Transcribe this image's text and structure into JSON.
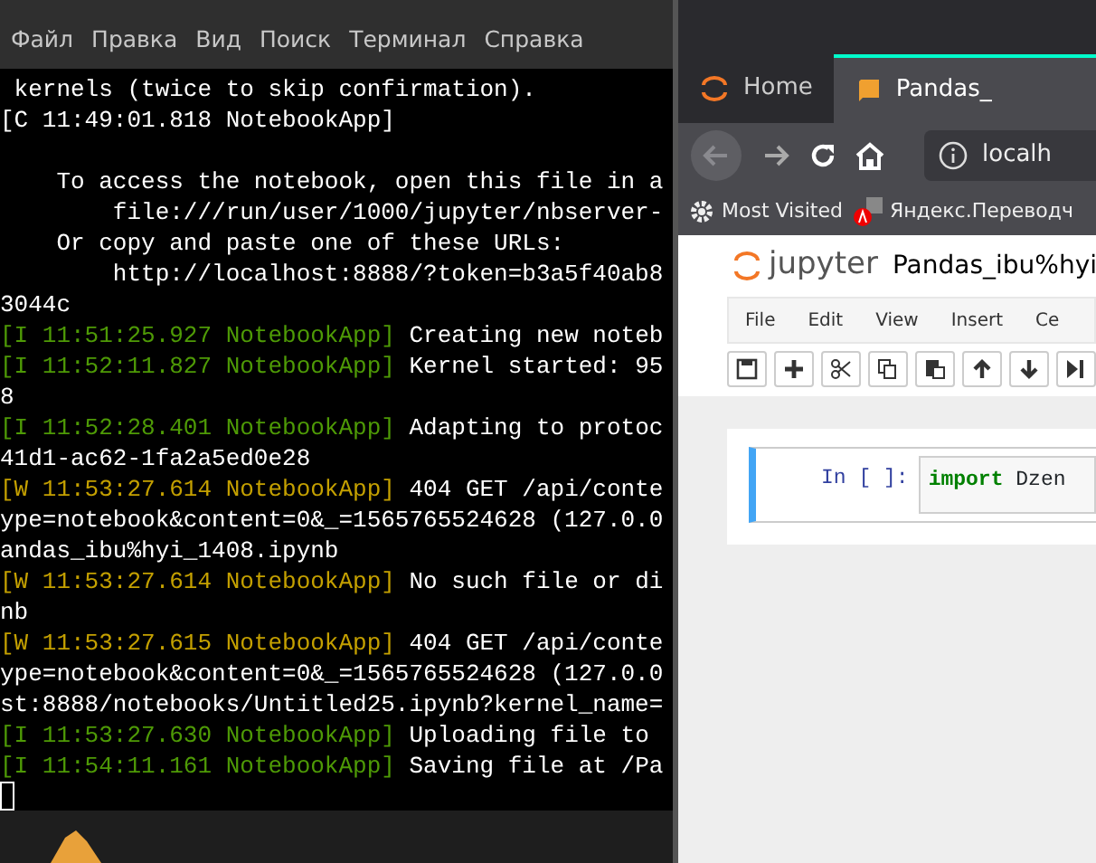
{
  "terminal": {
    "menu": [
      "Файл",
      "Правка",
      "Вид",
      "Поиск",
      "Терминал",
      "Справка"
    ],
    "lines": [
      {
        "kind": "plain",
        "text": " kernels (twice to skip confirmation)."
      },
      {
        "kind": "plain",
        "text": "[C 11:49:01.818 NotebookApp]"
      },
      {
        "kind": "blank"
      },
      {
        "kind": "plain",
        "text": "    To access the notebook, open this file in a"
      },
      {
        "kind": "plain",
        "text": "        file:///run/user/1000/jupyter/nbserver-"
      },
      {
        "kind": "plain",
        "text": "    Or copy and paste one of these URLs:"
      },
      {
        "kind": "plain",
        "text": "        http://localhost:8888/?token=b3a5f40ab8"
      },
      {
        "kind": "plain",
        "text": "3044c"
      },
      {
        "kind": "info",
        "prefix": "[I 11:51:25.927 NotebookApp]",
        "text": "Creating new noteb"
      },
      {
        "kind": "info",
        "prefix": "[I 11:52:11.827 NotebookApp]",
        "text": "Kernel started: 95"
      },
      {
        "kind": "plain",
        "text": "8"
      },
      {
        "kind": "info",
        "prefix": "[I 11:52:28.401 NotebookApp]",
        "text": "Adapting to protoc"
      },
      {
        "kind": "plain",
        "text": "41d1-ac62-1fa2a5ed0e28"
      },
      {
        "kind": "warn",
        "prefix": "[W 11:53:27.614 NotebookApp]",
        "text": "404 GET /api/conte"
      },
      {
        "kind": "plain",
        "text": "ype=notebook&content=0&_=1565765524628 (127.0.0"
      },
      {
        "kind": "plain",
        "text": "andas_ibu%hyi_1408.ipynb"
      },
      {
        "kind": "warn",
        "prefix": "[W 11:53:27.614 NotebookApp]",
        "text": "No such file or di"
      },
      {
        "kind": "plain",
        "text": "nb"
      },
      {
        "kind": "warn",
        "prefix": "[W 11:53:27.615 NotebookApp]",
        "text": "404 GET /api/conte"
      },
      {
        "kind": "plain",
        "text": "ype=notebook&content=0&_=1565765524628 (127.0.0"
      },
      {
        "kind": "plain",
        "text": "st:8888/notebooks/Untitled25.ipynb?kernel_name="
      },
      {
        "kind": "info",
        "prefix": "[I 11:53:27.630 NotebookApp]",
        "text": "Uploading file to"
      },
      {
        "kind": "info",
        "prefix": "[I 11:54:11.161 NotebookApp]",
        "text": "Saving file at /Pa"
      },
      {
        "kind": "cursor"
      }
    ]
  },
  "browser": {
    "tabs": [
      {
        "label": "Home",
        "selected": false
      },
      {
        "label": "Pandas_",
        "selected": true
      }
    ],
    "back_disabled": true,
    "url": "localh",
    "bookmarks": [
      {
        "label": "Most Visited"
      },
      {
        "label": "Яндекс.Переводч"
      }
    ]
  },
  "jupyter": {
    "logo": "jupyter",
    "notebook_title": "Pandas_ibu%hyi",
    "menu": [
      "File",
      "Edit",
      "View",
      "Insert",
      "Ce"
    ],
    "toolbar": [
      {
        "kind": "save"
      },
      {
        "kind": "add"
      },
      {
        "kind": "cut"
      },
      {
        "kind": "copy"
      },
      {
        "kind": "paste"
      },
      {
        "kind": "up"
      },
      {
        "kind": "down"
      },
      {
        "kind": "run"
      }
    ],
    "cell": {
      "prompt": "In [ ]:",
      "keyword": "import",
      "code": " Dzen"
    }
  }
}
